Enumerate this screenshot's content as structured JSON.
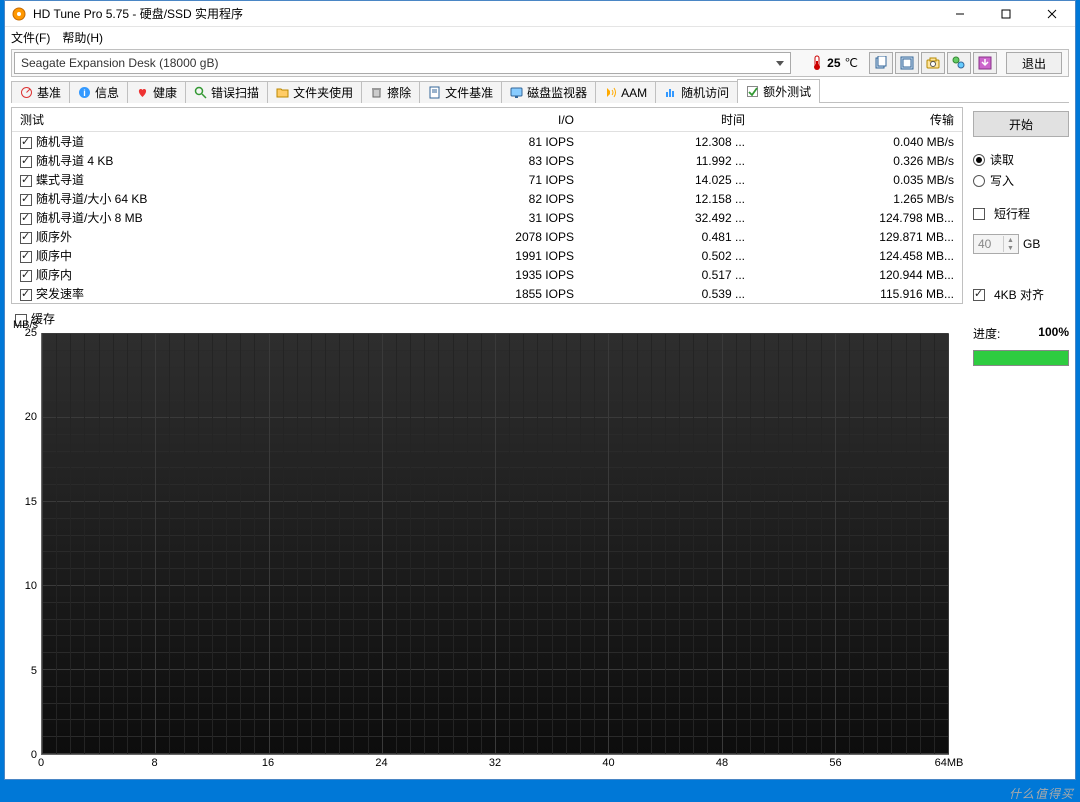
{
  "window": {
    "title": "HD Tune Pro 5.75 - 硬盘/SSD 实用程序"
  },
  "menu": {
    "file": "文件(F)",
    "help": "帮助(H)"
  },
  "toolbar": {
    "drive": "Seagate Expansion Desk (18000 gB)",
    "temp_value": "25",
    "temp_suffix": "℃",
    "exit": "退出"
  },
  "tabs": {
    "benchmark": "基准",
    "info": "信息",
    "health": "健康",
    "error_scan": "错误扫描",
    "folder_usage": "文件夹使用",
    "erase": "擦除",
    "file_bench": "文件基准",
    "disk_monitor": "磁盘监视器",
    "aam": "AAM",
    "random_access": "随机访问",
    "extra_tests": "额外测试"
  },
  "table": {
    "col_test": "测试",
    "col_io": "I/O",
    "col_time": "时间",
    "col_transfer": "传输",
    "rows": [
      {
        "name": "随机寻道",
        "io": "81 IOPS",
        "time": "12.308 ...",
        "xfer": "0.040 MB/s"
      },
      {
        "name": "随机寻道 4 KB",
        "io": "83 IOPS",
        "time": "11.992 ...",
        "xfer": "0.326 MB/s"
      },
      {
        "name": "蝶式寻道",
        "io": "71 IOPS",
        "time": "14.025 ...",
        "xfer": "0.035 MB/s"
      },
      {
        "name": "随机寻道/大小 64 KB",
        "io": "82 IOPS",
        "time": "12.158 ...",
        "xfer": "1.265 MB/s"
      },
      {
        "name": "随机寻道/大小 8 MB",
        "io": "31 IOPS",
        "time": "32.492 ...",
        "xfer": "124.798 MB..."
      },
      {
        "name": "顺序外",
        "io": "2078 IOPS",
        "time": "0.481 ...",
        "xfer": "129.871 MB..."
      },
      {
        "name": "顺序中",
        "io": "1991 IOPS",
        "time": "0.502 ...",
        "xfer": "124.458 MB..."
      },
      {
        "name": "顺序内",
        "io": "1935 IOPS",
        "time": "0.517 ...",
        "xfer": "120.944 MB..."
      },
      {
        "name": "突发速率",
        "io": "1855 IOPS",
        "time": "0.539 ...",
        "xfer": "115.916 MB..."
      }
    ]
  },
  "cache_label": "缓存",
  "side": {
    "start": "开始",
    "read": "读取",
    "write": "写入",
    "short_stroke": "短行程",
    "short_stroke_value": "40",
    "gb": "GB",
    "align_4kb": "4KB 对齐",
    "progress_label": "进度:",
    "progress_value": "100%"
  },
  "chart_data": {
    "type": "line",
    "title": "",
    "xlabel": "",
    "ylabel": "MB/s",
    "x_ticks": [
      "0",
      "8",
      "16",
      "24",
      "32",
      "40",
      "48",
      "56",
      "64MB"
    ],
    "y_ticks": [
      "0",
      "5",
      "10",
      "15",
      "20",
      "25"
    ],
    "xlim": [
      0,
      64
    ],
    "ylim": [
      0,
      25
    ],
    "series": []
  },
  "watermark": "什么值得买"
}
